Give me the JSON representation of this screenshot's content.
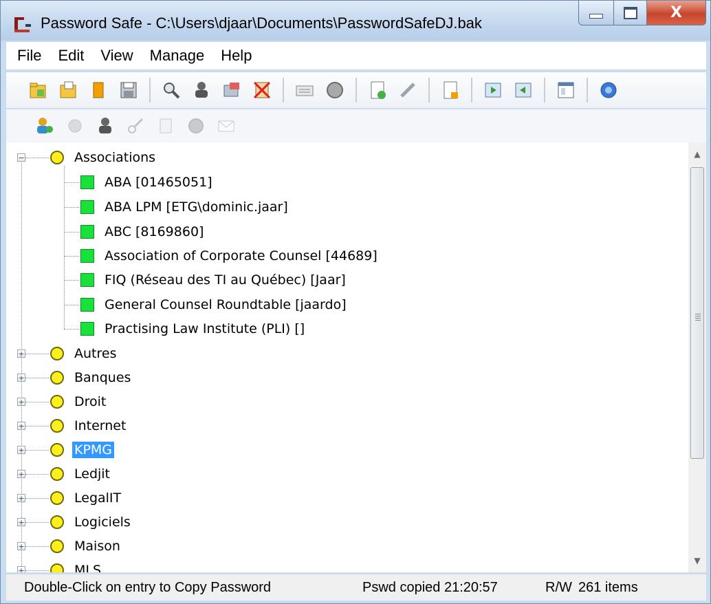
{
  "window": {
    "title": "Password Safe - C:\\Users\\djaar\\Documents\\PasswordSafeDJ.bak",
    "caption_close_glyph": "X"
  },
  "menu": [
    "File",
    "Edit",
    "View",
    "Manage",
    "Help"
  ],
  "toolbar_main": [
    "new-database-icon",
    "open-database-icon",
    "close-database-icon",
    "save-icon",
    "find-icon",
    "copy-username-icon",
    "copy-password-icon",
    "clear-clipboard-icon",
    "browse-url-icon",
    "autotype-icon",
    "add-entry-icon",
    "edit-entry-icon",
    "delete-entry-icon",
    "expand-all-icon",
    "collapse-all-icon",
    "options-icon",
    "help-icon"
  ],
  "toolbar_secondary": [
    "add-entry-icon",
    "run-icon",
    "copy-username-icon",
    "key-icon",
    "notes-icon",
    "password-icon",
    "email-icon"
  ],
  "tree": {
    "groups": [
      {
        "label": "Associations",
        "expanded": true,
        "entries": [
          "ABA [01465051]",
          "ABA LPM [ETG\\dominic.jaar]",
          "ABC [8169860]",
          "Association of Corporate Counsel [44689]",
          "FIQ (Réseau des TI au Québec) [Jaar]",
          "General Counsel Roundtable [jaardo]",
          "Practising Law Institute (PLI) []"
        ]
      },
      {
        "label": "Autres",
        "expanded": false
      },
      {
        "label": "Banques",
        "expanded": false
      },
      {
        "label": "Droit",
        "expanded": false
      },
      {
        "label": "Internet",
        "expanded": false
      },
      {
        "label": "KPMG",
        "expanded": false,
        "selected": true
      },
      {
        "label": "Ledjit",
        "expanded": false
      },
      {
        "label": "LegalIT",
        "expanded": false
      },
      {
        "label": "Logiciels",
        "expanded": false
      },
      {
        "label": "Maison",
        "expanded": false
      },
      {
        "label": "MLS",
        "expanded": false
      }
    ]
  },
  "status": {
    "hint": "Double-Click on entry to Copy Password",
    "clipboard": "Pswd copied 21:20:57",
    "mode": "R/W",
    "count": "261 items"
  },
  "colors": {
    "group_icon": "#ffef1a",
    "entry_icon": "#18e23a",
    "selection": "#3399ff"
  }
}
